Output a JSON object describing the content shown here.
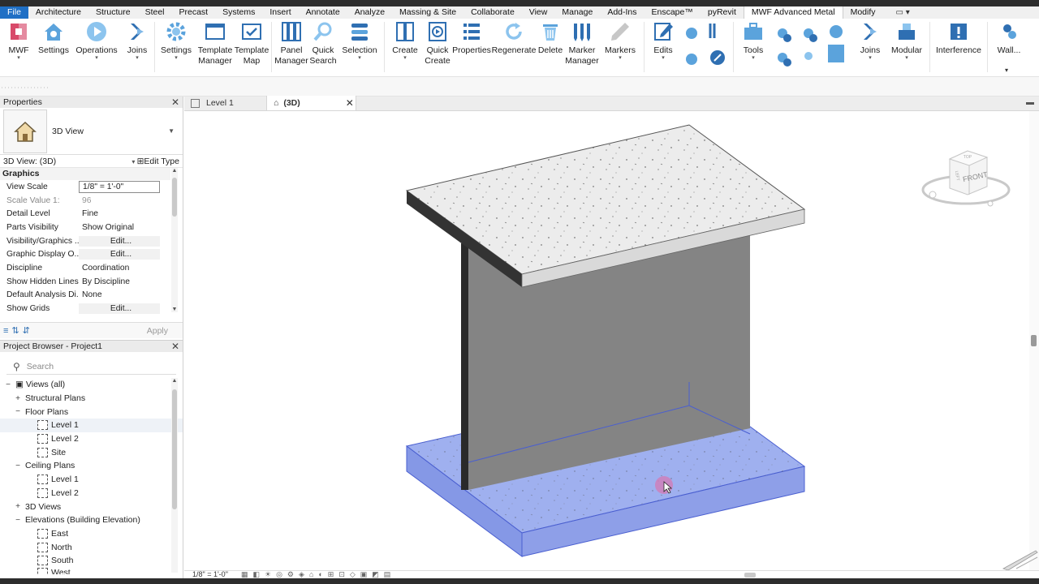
{
  "menu": [
    "File",
    "Architecture",
    "Structure",
    "Steel",
    "Precast",
    "Systems",
    "Insert",
    "Annotate",
    "Analyze",
    "Massing & Site",
    "Collaborate",
    "View",
    "Manage",
    "Add-Ins",
    "Enscape™",
    "pyRevit",
    "MWF Advanced Metal",
    "Modify"
  ],
  "menu_extra": "▭ ▾",
  "ribbon": {
    "mwf": "MWF",
    "settings1": "Settings",
    "operations": "Operations",
    "joins1": "Joins",
    "settings2": "Settings",
    "template_manager": "Template Manager",
    "template_map": "Template Map",
    "panel_manager": "Panel Manager",
    "quick_search": "Quick Search",
    "selection": "Selection",
    "create": "Create",
    "quick_create": "Quick Create",
    "properties": "Properties",
    "regenerate": "Regenerate",
    "delete": "Delete",
    "marker_manager": "Marker Manager",
    "markers": "Markers",
    "edits": "Edits",
    "tools": "Tools",
    "joins2": "Joins",
    "modular": "Modular",
    "interference": "Interference",
    "wall": "Wall..."
  },
  "properties": {
    "title": "Properties",
    "type_name": "3D View",
    "instance": "3D View: (3D)",
    "edit_type": "Edit Type",
    "group": "Graphics",
    "rows": [
      {
        "name": "View Scale",
        "value": "1/8\" = 1'-0\""
      },
      {
        "name": "Scale Value    1:",
        "value": "96"
      },
      {
        "name": "Detail Level",
        "value": "Fine"
      },
      {
        "name": "Parts Visibility",
        "value": "Show Original"
      },
      {
        "name": "Visibility/Graphics ...",
        "value": "Edit..."
      },
      {
        "name": "Graphic Display O...",
        "value": "Edit..."
      },
      {
        "name": "Discipline",
        "value": "Coordination"
      },
      {
        "name": "Show Hidden Lines",
        "value": "By Discipline"
      },
      {
        "name": "Default Analysis Di...",
        "value": "None"
      },
      {
        "name": "Show Grids",
        "value": "Edit..."
      }
    ],
    "apply": "Apply"
  },
  "browser": {
    "title": "Project Browser - Project1",
    "search_placeholder": "Search",
    "items": [
      {
        "label": "Views (all)"
      },
      {
        "label": "Structural Plans"
      },
      {
        "label": "Floor Plans"
      },
      {
        "label": "Level 1"
      },
      {
        "label": "Level 2"
      },
      {
        "label": "Site"
      },
      {
        "label": "Ceiling Plans"
      },
      {
        "label": "Level 1"
      },
      {
        "label": "Level 2"
      },
      {
        "label": "3D Views"
      },
      {
        "label": "Elevations (Building Elevation)"
      },
      {
        "label": "East"
      },
      {
        "label": "North"
      },
      {
        "label": "South"
      },
      {
        "label": "West"
      }
    ]
  },
  "tabs": {
    "level1": "Level 1",
    "view3d": "(3D)"
  },
  "viewcube": {
    "front": "FRONT",
    "top": "TOP",
    "left": "LEFT"
  },
  "status": {
    "scale": "1/8\" = 1'-0\""
  }
}
